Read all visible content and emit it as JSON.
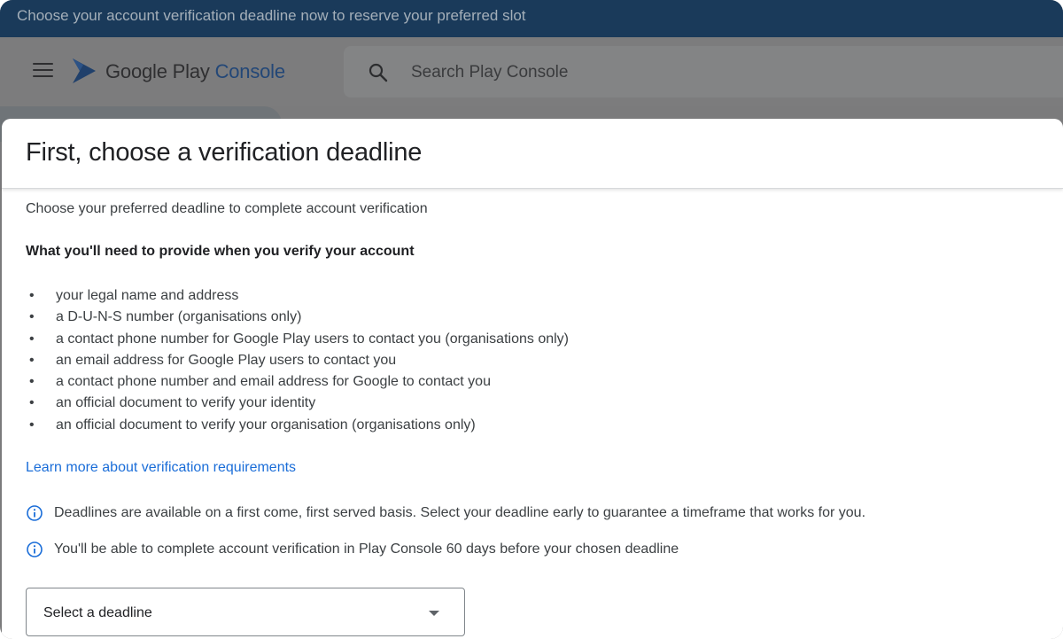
{
  "banner": {
    "text": "Choose your account verification deadline now to reserve your preferred slot"
  },
  "header": {
    "brand_main": "Google Play",
    "brand_accent": "Console",
    "search_placeholder": "Search Play Console"
  },
  "dialog": {
    "title": "First, choose a verification deadline",
    "intro": "Choose your preferred deadline to complete account verification",
    "need_title": "What you'll need to provide when you verify your account",
    "requirements": [
      "your legal name and address",
      "a D-U-N-S number (organisations only)",
      "a contact phone number for Google Play users to contact you (organisations only)",
      "an email address for Google Play users to contact you",
      "a contact phone number and email address for Google to contact you",
      "an official document to verify your identity",
      "an official document to verify your organisation (organisations only)"
    ],
    "learn_more": "Learn more about verification requirements",
    "notes": [
      "Deadlines are available on a first come, first served basis. Select your deadline early to guarantee a timeframe that works for you.",
      "You'll be able to complete account verification in Play Console 60 days before your chosen deadline"
    ],
    "select_label": "Select a deadline"
  },
  "colors": {
    "banner_bg": "#1a3a5a",
    "link": "#1a6dd8",
    "brand_accent": "#234777"
  },
  "icons": [
    "menu-icon",
    "play-console-logo-icon",
    "search-icon",
    "info-icon",
    "dropdown-caret-icon"
  ]
}
